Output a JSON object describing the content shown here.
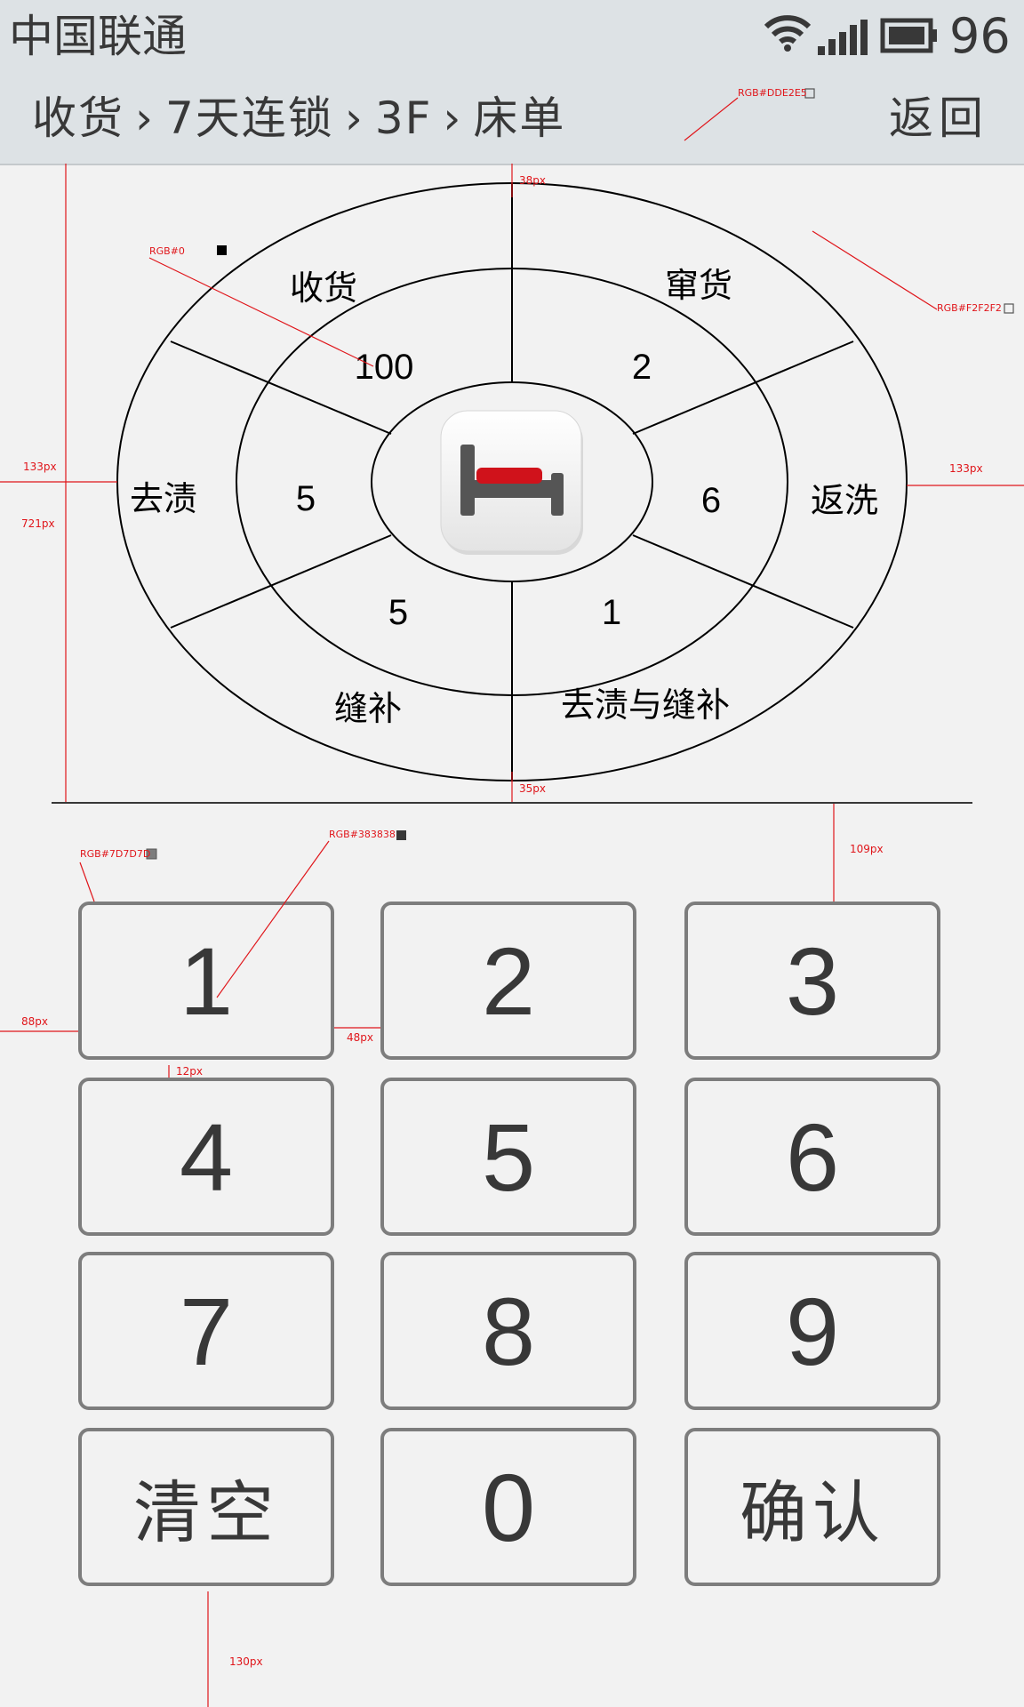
{
  "status_bar": {
    "carrier": "中国联通",
    "battery_level": "96",
    "icons": [
      "wifi-icon",
      "signal-icon",
      "battery-icon"
    ]
  },
  "nav": {
    "breadcrumb": [
      "收货",
      "7天连锁",
      "3F",
      "床单"
    ],
    "separator": "›",
    "back_label": "返回"
  },
  "ring": {
    "center_icon": "bed-icon",
    "segments": [
      {
        "label": "收货",
        "count": "100"
      },
      {
        "label": "窜货",
        "count": "2"
      },
      {
        "label": "返洗",
        "count": "6"
      },
      {
        "label": "去渍与缝补",
        "count": "1"
      },
      {
        "label": "缝补",
        "count": "5"
      },
      {
        "label": "去渍",
        "count": "5"
      }
    ]
  },
  "keypad": {
    "keys": [
      "1",
      "2",
      "3",
      "4",
      "5",
      "6",
      "7",
      "8",
      "9",
      "清空",
      "0",
      "确认"
    ]
  },
  "annotations": {
    "color_nav": "RGB#DDE2E5",
    "color_black": "RGB#0",
    "color_bg": "RGB#F2F2F2",
    "color_border": "RGB#7D7D7D",
    "color_text": "RGB#383838",
    "dims": [
      "38px",
      "133px",
      "721px",
      "133px",
      "35px",
      "109px",
      "88px",
      "48px",
      "12px",
      "130px"
    ]
  },
  "colors": {
    "nav_bg": "#DDE2E5",
    "page_bg": "#F2F2F2",
    "key_border": "#7D7D7D",
    "text": "#383838",
    "accent": "#E0161B"
  }
}
